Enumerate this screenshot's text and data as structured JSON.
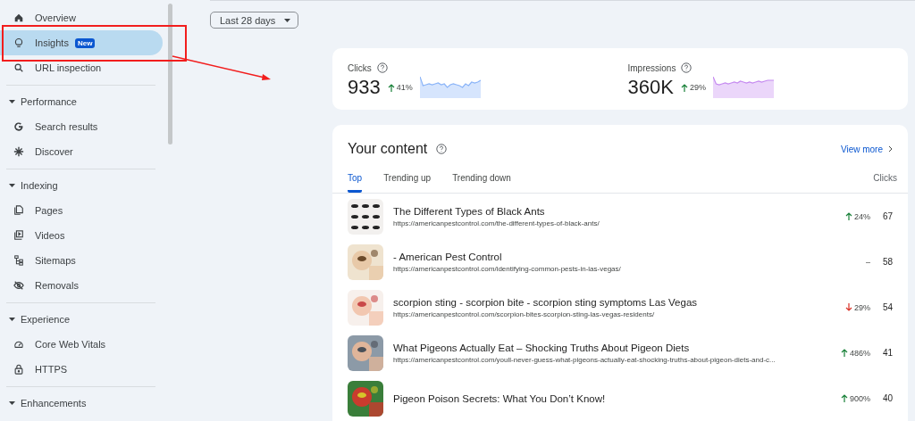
{
  "sidebar": {
    "items": [
      {
        "kind": "item",
        "label": "Overview",
        "selected": false
      },
      {
        "kind": "item",
        "label": "Insights",
        "badge": "New",
        "selected": true
      },
      {
        "kind": "item",
        "label": "URL inspection",
        "selected": false
      },
      {
        "kind": "divider"
      },
      {
        "kind": "section",
        "label": "Performance",
        "expanded": true
      },
      {
        "kind": "item",
        "label": "Search results",
        "selected": false
      },
      {
        "kind": "item",
        "label": "Discover",
        "selected": false
      },
      {
        "kind": "divider"
      },
      {
        "kind": "section",
        "label": "Indexing",
        "expanded": true
      },
      {
        "kind": "item",
        "label": "Pages",
        "selected": false
      },
      {
        "kind": "item",
        "label": "Videos",
        "selected": false
      },
      {
        "kind": "item",
        "label": "Sitemaps",
        "selected": false
      },
      {
        "kind": "item",
        "label": "Removals",
        "selected": false
      },
      {
        "kind": "divider"
      },
      {
        "kind": "section",
        "label": "Experience",
        "expanded": true
      },
      {
        "kind": "item",
        "label": "Core Web Vitals",
        "selected": false
      },
      {
        "kind": "item",
        "label": "HTTPS",
        "selected": false
      },
      {
        "kind": "divider"
      },
      {
        "kind": "section",
        "label": "Enhancements",
        "expanded": true
      }
    ]
  },
  "date_range": {
    "label": "Last 28 days"
  },
  "metrics": [
    {
      "kind": "up",
      "label": "Clicks",
      "value": "933",
      "change": "41%",
      "color": "#8ab4f8"
    },
    {
      "kind": "up",
      "label": "Impressions",
      "value": "360K",
      "change": "29%",
      "color": "#c58af0"
    }
  ],
  "content": {
    "title": "Your content",
    "view_more": "View more",
    "tabs": [
      {
        "label": "Top",
        "selected": true
      },
      {
        "label": "Trending up",
        "selected": false
      },
      {
        "label": "Trending down",
        "selected": false
      }
    ],
    "column": "Clicks",
    "rows": [
      {
        "title": "The Different Types of Black Ants",
        "url": "https://americanpestcontrol.com/the-different-types-of-black-ants/",
        "kind": "up",
        "change": "24%",
        "clicks": "67"
      },
      {
        "title": "- American Pest Control",
        "url": "https://americanpestcontrol.com/identifying-common-pests-in-las-vegas/",
        "kind": "flat",
        "change": "–",
        "clicks": "58"
      },
      {
        "title": "scorpion sting - scorpion bite - scorpion sting symptoms Las Vegas",
        "url": "https://americanpestcontrol.com/scorpion-bites-scorpion-sting-las-vegas-residents/",
        "kind": "down",
        "change": "29%",
        "clicks": "54"
      },
      {
        "title": "What Pigeons Actually Eat – Shocking Truths About Pigeon Diets",
        "url": "https://americanpestcontrol.com/youll-never-guess-what-pigeons-actually-eat-shocking-truths-about-pigeon-diets-and-c...",
        "kind": "up",
        "change": "486%",
        "clicks": "41"
      },
      {
        "title": "Pigeon Poison Secrets: What You Don’t Know!",
        "kind": "up",
        "change": "900%",
        "clicks": "40"
      }
    ]
  }
}
